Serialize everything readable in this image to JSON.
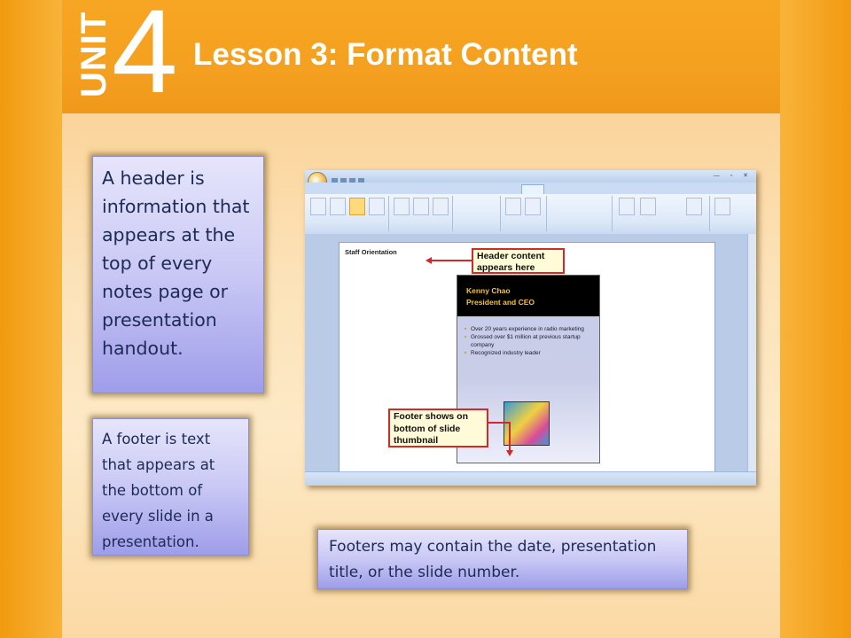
{
  "header": {
    "unit_word": "UNIT",
    "unit_number": "4",
    "lesson_title": "Lesson 3: Format Content"
  },
  "boxes": {
    "header_text": "A header is information that appears at the top of every notes page or presentation handout.",
    "footer_text": "A footer is text that appears at the bottom of every slide in a presentation.",
    "footer_note": "Footers may contain the date, presentation title, or the slide number."
  },
  "screenshot": {
    "page_header_text": "Staff Orientation",
    "callout_header": "Header content appears here",
    "callout_footer": "Footer shows on bottom of slide thumbnail",
    "slide_name": "Kenny Chao",
    "slide_title": "President and CEO",
    "slide_bullets": [
      "Over 20 years experience in radio marketing",
      "Grossed over $1 million at previous startup company",
      "Recognized industry leader"
    ]
  },
  "colors": {
    "orange_background": "#f6a21c",
    "content_background": "#fde9c6",
    "box_fill": "#c9c8f5",
    "box_text": "#1c2a55",
    "callout_border": "#d02a2a"
  }
}
